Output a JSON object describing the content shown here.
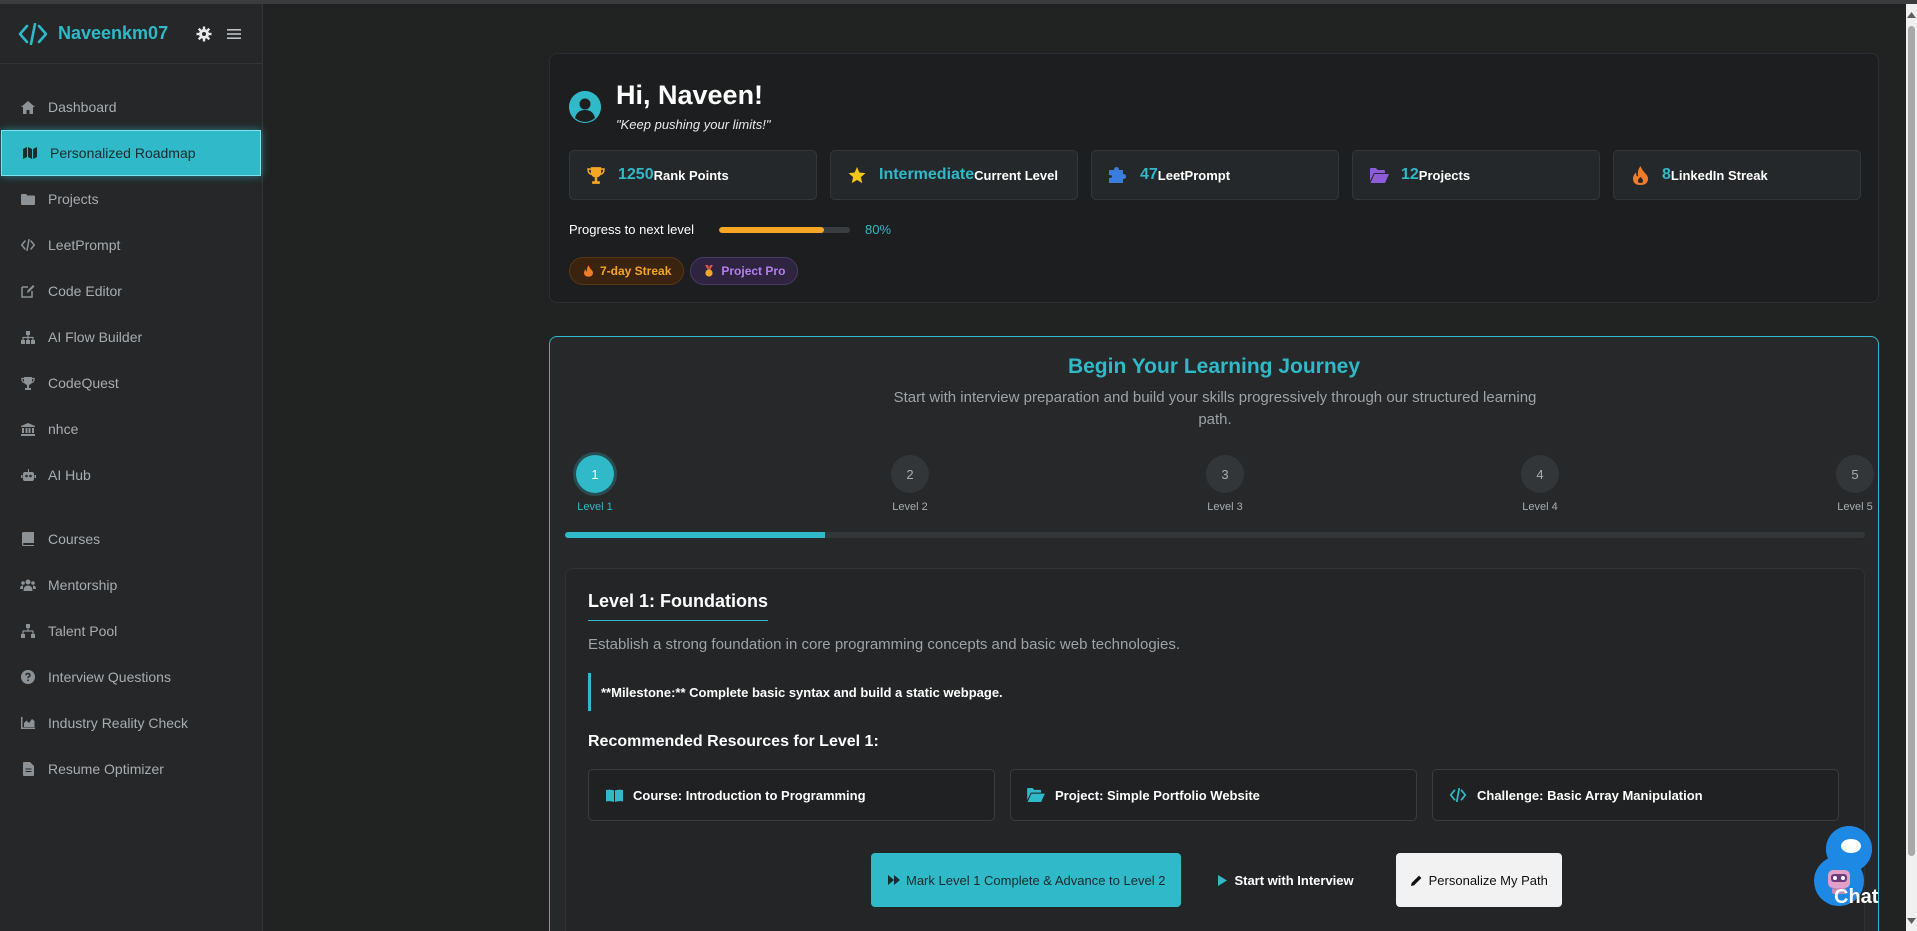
{
  "brand": {
    "name": "Naveenkm07"
  },
  "nav": {
    "items": [
      {
        "label": "Dashboard",
        "icon": "home-icon"
      },
      {
        "label": "Personalized Roadmap",
        "icon": "map-icon",
        "active": true
      },
      {
        "label": "Projects",
        "icon": "folder-icon"
      },
      {
        "label": "LeetPrompt",
        "icon": "code-icon"
      },
      {
        "label": "Code Editor",
        "icon": "edit-icon"
      },
      {
        "label": "AI Flow Builder",
        "icon": "sitemap-icon"
      },
      {
        "label": "CodeQuest",
        "icon": "trophy-icon"
      },
      {
        "label": "nhce",
        "icon": "university-icon"
      },
      {
        "label": "AI Hub",
        "icon": "robot-icon"
      }
    ],
    "items2": [
      {
        "label": "Courses",
        "icon": "book-icon"
      },
      {
        "label": "Mentorship",
        "icon": "users-icon"
      },
      {
        "label": "Talent Pool",
        "icon": "network-icon"
      },
      {
        "label": "Interview Questions",
        "icon": "question-icon"
      },
      {
        "label": "Industry Reality Check",
        "icon": "chart-icon"
      },
      {
        "label": "Resume Optimizer",
        "icon": "file-icon"
      }
    ]
  },
  "profile": {
    "greeting": "Hi, Naveen!",
    "quote": "\"Keep pushing your limits!\"",
    "stats": [
      {
        "value": "1250",
        "label": "Rank Points",
        "icon": "trophy-icon",
        "color": "#f5a623"
      },
      {
        "value": "Intermediate",
        "label": "Current Level",
        "icon": "star-icon",
        "color": "#f5c518"
      },
      {
        "value": "47",
        "label": "LeetPrompt",
        "icon": "puzzle-icon",
        "color": "#3b7ddd"
      },
      {
        "value": "12",
        "label": "Projects",
        "icon": "folder-open-icon",
        "color": "#8e5cd9"
      },
      {
        "value": "8",
        "label": "LinkedIn Streak",
        "icon": "fire-icon",
        "color": "#f07b2a"
      }
    ],
    "progress": {
      "label": "Progress to next level",
      "value": 80,
      "display": "80%"
    },
    "badges": [
      {
        "label": "7-day Streak",
        "icon": "fire-icon"
      },
      {
        "label": "Project Pro",
        "icon": "medal-icon"
      }
    ]
  },
  "journey": {
    "title": "Begin Your Learning Journey",
    "subtitle": "Start with interview preparation and build your skills progressively through our structured learning path.",
    "steps": [
      {
        "number": "1",
        "label": "Level 1",
        "active": true
      },
      {
        "number": "2",
        "label": "Level 2"
      },
      {
        "number": "3",
        "label": "Level 3"
      },
      {
        "number": "4",
        "label": "Level 4"
      },
      {
        "number": "5",
        "label": "Level 5"
      }
    ],
    "step_progress": 0.2,
    "level": {
      "title": "Level 1: Foundations",
      "description": "Establish a strong foundation in core programming concepts and basic web technologies.",
      "milestone": "**Milestone:** Complete basic syntax and build a static webpage.",
      "resources_title": "Recommended Resources for Level 1:",
      "resources": [
        {
          "label": "Course: Introduction to Programming",
          "icon": "book-open-icon"
        },
        {
          "label": "Project: Simple Portfolio Website",
          "icon": "folder-open-icon"
        },
        {
          "label": "Challenge: Basic Array Manipulation",
          "icon": "code-icon"
        }
      ]
    },
    "actions": {
      "primary": "Mark Level 1 Complete & Advance to Level 2",
      "interview": "Start with Interview",
      "personalize": "Personalize My Path"
    }
  },
  "chat": {
    "label": "Chat"
  },
  "colors": {
    "accent": "#2fb9c9",
    "progress": "#f5a623",
    "background": "#212323"
  }
}
